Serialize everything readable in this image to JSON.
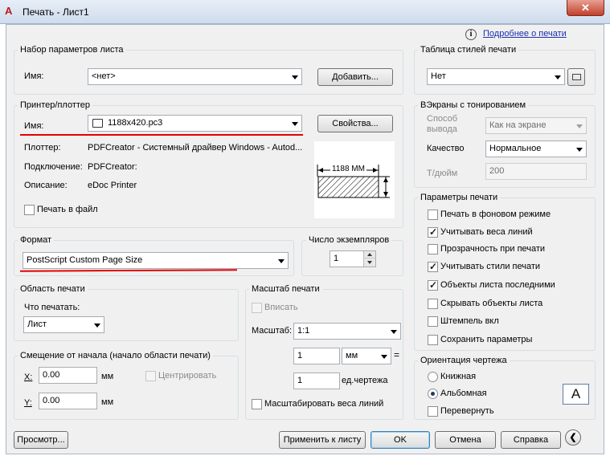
{
  "window": {
    "logo": "A",
    "title": "Печать - Лист1",
    "close_glyph": "✕"
  },
  "help": {
    "icon": "info-icon",
    "link": "Подробнее о печати"
  },
  "page_setup": {
    "title": "Набор параметров листа",
    "name_label": "Имя:",
    "name_value": "<нет>",
    "add_button": "Добавить..."
  },
  "plotter": {
    "title": "Принтер/плоттер",
    "name_label": "Имя:",
    "name_value": "1188x420.pc3",
    "properties_button": "Свойства...",
    "plotter_label": "Плоттер:",
    "plotter_value": "PDFCreator - Системный драйвер Windows - Autod...",
    "port_label": "Подключение:",
    "port_value": "PDFCreator:",
    "description_label": "Описание:",
    "description_value": "eDoc Printer",
    "print_to_file": "Печать в файл",
    "print_to_file_checked": false,
    "preview_dimension": "1188 MM"
  },
  "format": {
    "title": "Формат",
    "value": "PostScript Custom Page Size"
  },
  "copies": {
    "title": "Число экземпляров",
    "value": "1"
  },
  "plot_area": {
    "title": "Область печати",
    "what_label": "Что печатать:",
    "what_value": "Лист"
  },
  "offset": {
    "title": "Смещение от начала (начало области печати)",
    "x_label": "X:",
    "x_value": "0.00",
    "x_unit": "мм",
    "y_label": "Y:",
    "y_value": "0.00",
    "y_unit": "мм",
    "center_label": "Центрировать",
    "center_checked": false
  },
  "scale": {
    "title": "Масштаб печати",
    "fit_label": "Вписать",
    "fit_checked": false,
    "scale_label": "Масштаб:",
    "scale_value": "1:1",
    "value1": "1",
    "unit1": "мм",
    "equals": "=",
    "value2": "1",
    "unit2": "ед.чертежа",
    "lineweights_label": "Масштабировать веса линий",
    "lineweights_checked": false
  },
  "style_table": {
    "title": "Таблица стилей печати",
    "value": "Нет",
    "edit_icon": "edit-table-icon"
  },
  "shaded": {
    "title": "ВЭкраны с тонированием",
    "mode_label": "Способ вывода",
    "mode_value": "Как на экране",
    "quality_label": "Качество",
    "quality_value": "Нормальное",
    "dpi_label": "Т/дюйм",
    "dpi_value": "200"
  },
  "options": {
    "title": "Параметры печати",
    "items": [
      {
        "label": "Печать в фоновом режиме",
        "checked": false
      },
      {
        "label": "Учитывать веса линий",
        "checked": true
      },
      {
        "label": "Прозрачность при печати",
        "checked": false
      },
      {
        "label": "Учитывать стили печати",
        "checked": true
      },
      {
        "label": "Объекты листа последними",
        "checked": true
      },
      {
        "label": "Скрывать объекты листа",
        "checked": false
      },
      {
        "label": "Штемпель вкл",
        "checked": false
      },
      {
        "label": "Сохранить параметры",
        "checked": false
      }
    ]
  },
  "orientation": {
    "title": "Ориентация чертежа",
    "portrait": "Книжная",
    "landscape": "Альбомная",
    "selected": "landscape",
    "upside_down": "Перевернуть",
    "upside_down_checked": false,
    "icon_letter": "A"
  },
  "footer": {
    "preview": "Просмотр...",
    "apply": "Применить к листу",
    "ok": "OK",
    "cancel": "Отмена",
    "help": "Справка",
    "collapse_glyph": "❮"
  },
  "colors": {
    "annotation_red": "#e60000",
    "link_blue": "#1a2fb0"
  }
}
